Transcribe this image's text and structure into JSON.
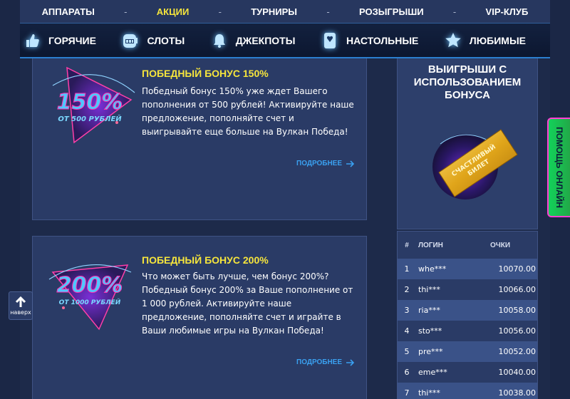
{
  "topnav": {
    "items": [
      {
        "label": "АППАРАТЫ",
        "active": false
      },
      {
        "label": "АКЦИИ",
        "active": true
      },
      {
        "label": "ТУРНИРЫ",
        "active": false
      },
      {
        "label": "РОЗЫГРЫШИ",
        "active": false
      },
      {
        "label": "VIP-КЛУБ",
        "active": false
      }
    ],
    "separator": "-"
  },
  "categories": [
    {
      "label": "ГОРЯЧИЕ",
      "icon": "thumbs-up-icon"
    },
    {
      "label": "СЛОТЫ",
      "icon": "slot-machine-icon"
    },
    {
      "label": "ДЖЕКПОТЫ",
      "icon": "bell-icon"
    },
    {
      "label": "НАСТОЛЬНЫЕ",
      "icon": "playing-card-icon"
    },
    {
      "label": "ЛЮБИМЫЕ",
      "icon": "star-icon"
    }
  ],
  "promos": [
    {
      "title": "ПОБЕДНЫЙ БОНУС 150%",
      "description": "Победный бонус 150% уже ждет Вашего пополнения от 500 рублей! Активируйте наше предложение, пополняйте счет и выигрывайте еще больше на Вулкан Победа!",
      "badge_big": "150%",
      "badge_small": "ОТ 500 РУБЛЕЙ",
      "more_label": "ПОДРОБНЕЕ"
    },
    {
      "title": "ПОБЕДНЫЙ БОНУС 200%",
      "description": "Что может быть лучше, чем бонус 200%? Победный бонус 200% за Ваше пополнение от 1 000 рублей. Активируйте наше предложение, пополняйте счет и играйте в Ваши любимые игры на Вулкан Победа!",
      "badge_big": "200%",
      "badge_small": "ОТ 1000 РУБЛЕЙ",
      "more_label": "ПОДРОБНЕЕ"
    }
  ],
  "sidepanel": {
    "title": "ВЫИГРЫШИ С ИСПОЛЬЗОВАНИЕМ БОНУСА",
    "ticket_text_1": "СЧАСТЛИВЫЙ",
    "ticket_text_2": "БИЛЕТ"
  },
  "winners": {
    "headers": {
      "num": "#",
      "login": "ЛОГИН",
      "points": "ОЧКИ"
    },
    "rows": [
      {
        "num": "1",
        "login": "whe***",
        "points": "10070.00"
      },
      {
        "num": "2",
        "login": "thi***",
        "points": "10066.00"
      },
      {
        "num": "3",
        "login": "ria***",
        "points": "10058.00"
      },
      {
        "num": "4",
        "login": "sto***",
        "points": "10056.00"
      },
      {
        "num": "5",
        "login": "pre***",
        "points": "10052.00"
      },
      {
        "num": "6",
        "login": "eme***",
        "points": "10040.00"
      },
      {
        "num": "7",
        "login": "thi***",
        "points": "10038.00"
      }
    ]
  },
  "totop_label": "наверх",
  "help_label": "ПОМОЩЬ ОНЛАЙН",
  "colors": {
    "accent_yellow": "#f6e53c",
    "link_blue": "#3aa0f0",
    "help_green": "#12d25a"
  }
}
